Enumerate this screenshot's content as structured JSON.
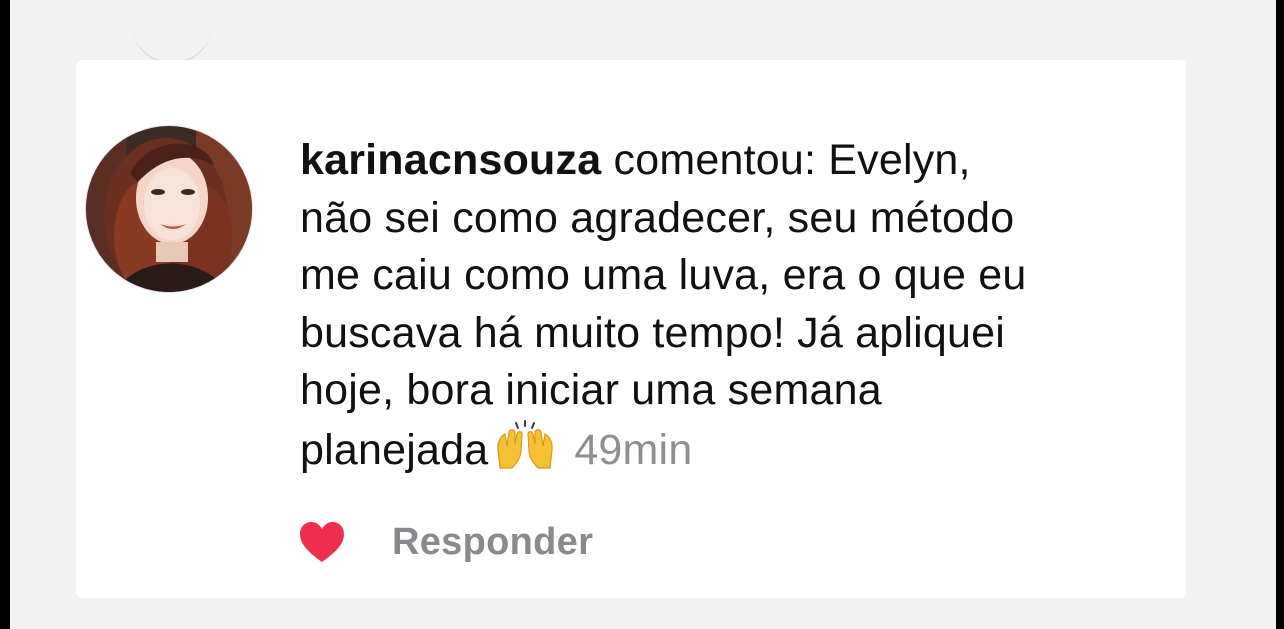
{
  "comment": {
    "username": "karinacnsouza",
    "action_text": "comentou:",
    "line1_text": "Evelyn,",
    "line2": "não sei como agradecer, seu método",
    "line3": "me caiu como uma luva, era o que eu",
    "line4": "buscava há muito tempo! Já apliquei",
    "line5": "hoje, bora iniciar uma semana",
    "line6": "planejada",
    "emoji": "raising-hands-icon",
    "timestamp": "49min",
    "liked": true
  },
  "actions": {
    "reply_label": "Responder"
  },
  "colors": {
    "heart": "#ee2f4e",
    "timestamp": "#8e8e93",
    "reply": "#8a8a8e",
    "text": "#111111",
    "background": "#f2f2f3",
    "card": "#ffffff"
  }
}
